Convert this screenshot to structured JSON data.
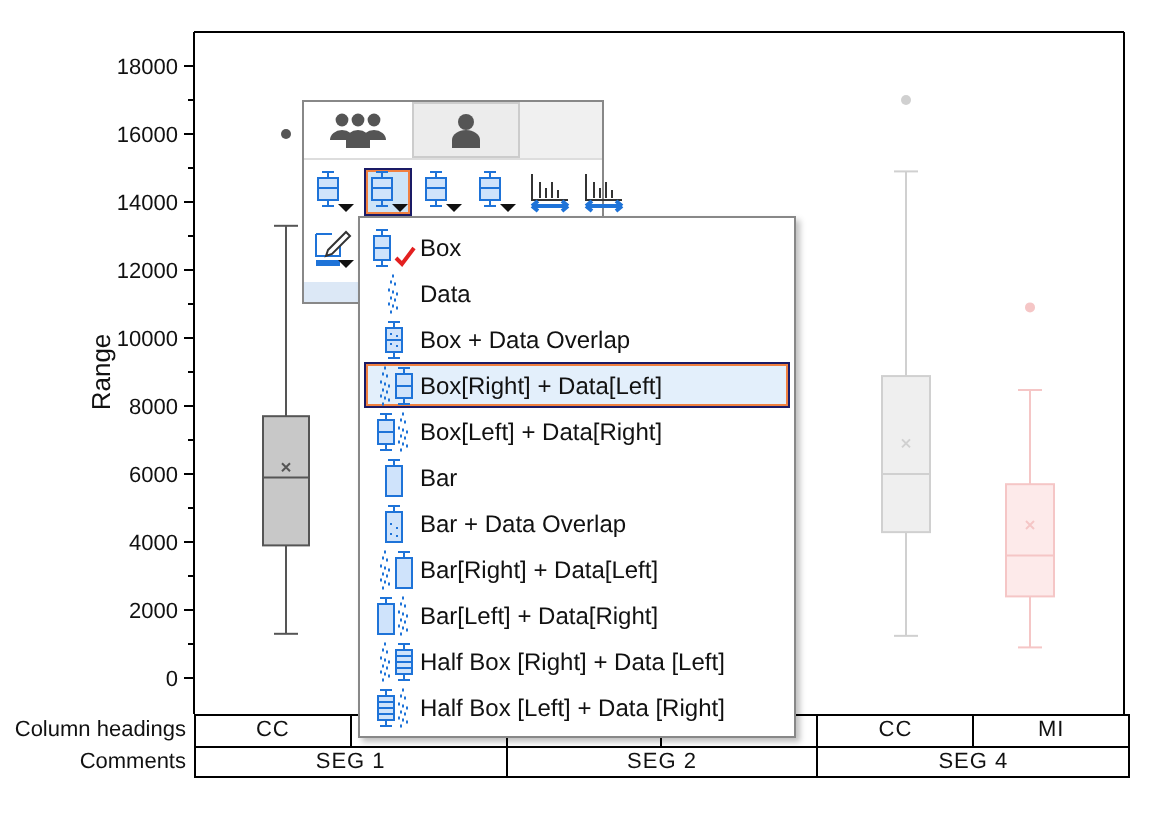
{
  "plot": {
    "ylabel": "Range",
    "ytick_labels": [
      "18000",
      "16000",
      "14000",
      "12000",
      "10000",
      "8000",
      "6000",
      "4000",
      "2000",
      "0"
    ]
  },
  "table": {
    "rows": [
      {
        "label": "Column headings",
        "cells": [
          {
            "text": "CC"
          },
          {
            "text": null
          },
          {
            "text": null
          },
          {
            "text": null
          },
          {
            "text": "CC"
          },
          {
            "text": "MI"
          }
        ]
      },
      {
        "label": "Comments",
        "cells": [
          {
            "text": "SEG 1"
          },
          {
            "text": "SEG 2"
          },
          {
            "text": "SEG 4"
          }
        ]
      }
    ]
  },
  "toolbar": {
    "tabs": [
      {
        "selected": true
      },
      {
        "selected": false
      }
    ],
    "buttons": [
      {
        "selected": false
      },
      {
        "selected": true
      },
      {
        "selected": false
      },
      {
        "selected": false
      },
      {
        "selected": false
      },
      {
        "selected": false
      },
      {
        "selected": false
      }
    ]
  },
  "menu": {
    "items": [
      {
        "label": "Box",
        "checked": true,
        "selected": false
      },
      {
        "label": "Data",
        "checked": false,
        "selected": false
      },
      {
        "label": "Box + Data Overlap",
        "checked": false,
        "selected": false
      },
      {
        "label": "Box[Right] + Data[Left]",
        "checked": false,
        "selected": true
      },
      {
        "label": "Box[Left] + Data[Right]",
        "checked": false,
        "selected": false
      },
      {
        "label": "Bar",
        "checked": false,
        "selected": false
      },
      {
        "label": "Bar + Data Overlap",
        "checked": false,
        "selected": false
      },
      {
        "label": "Bar[Right] + Data[Left]",
        "checked": false,
        "selected": false
      },
      {
        "label": "Bar[Left] + Data[Right]",
        "checked": false,
        "selected": false
      },
      {
        "label": "Half Box [Right] + Data [Left]",
        "checked": false,
        "selected": false
      },
      {
        "label": "Half Box [Left] + Data [Right]",
        "checked": false,
        "selected": false
      }
    ]
  }
}
